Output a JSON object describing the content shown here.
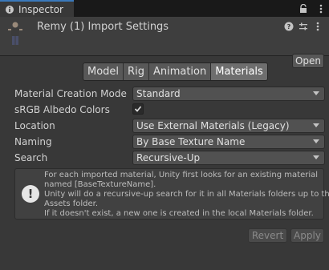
{
  "window": {
    "tab_title": "Inspector"
  },
  "header": {
    "title": "Remy (1) Import Settings",
    "open_label": "Open"
  },
  "subtabs": [
    "Model",
    "Rig",
    "Animation",
    "Materials"
  ],
  "active_subtab": "Materials",
  "fields": {
    "material_creation_mode": {
      "label": "Material Creation Mode",
      "value": "Standard"
    },
    "srgb_albedo": {
      "label": "sRGB Albedo Colors",
      "checked": true
    },
    "location": {
      "label": "Location",
      "value": "Use External Materials (Legacy)"
    },
    "naming": {
      "label": "Naming",
      "value": "By Base Texture Name"
    },
    "search": {
      "label": "Search",
      "value": "Recursive-Up"
    }
  },
  "info": {
    "lines": [
      "For each imported material, Unity first looks for an existing material",
      "named [BaseTextureName].",
      "Unity will do a recursive-up search for it in all Materials folders up to the",
      "Assets folder.",
      "If it doesn't exist, a new one is created in the local Materials folder."
    ]
  },
  "footer": {
    "revert_label": "Revert",
    "apply_label": "Apply"
  },
  "colors": {
    "accent": "#3a79bb",
    "background": "#383838"
  }
}
